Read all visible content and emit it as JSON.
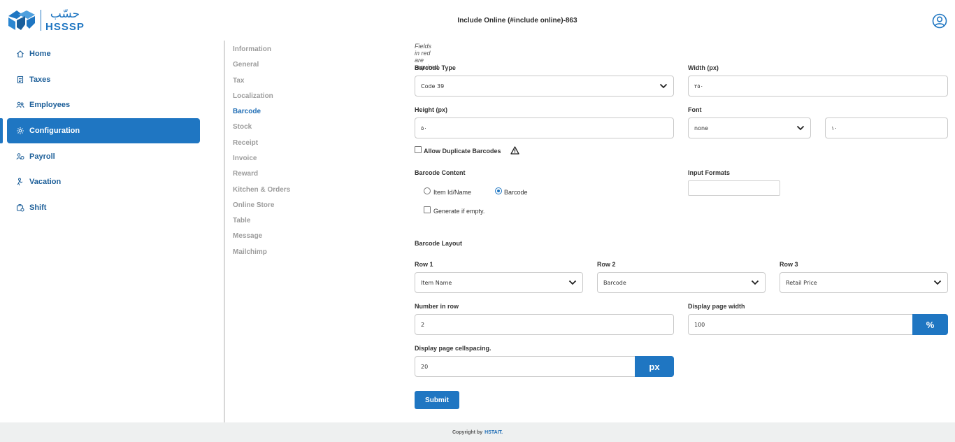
{
  "header": {
    "logo_ar": "حسّب",
    "logo_en": "HSSSP",
    "title": "Include Online (#include online)-863"
  },
  "sidebar": {
    "items": [
      {
        "label": "Home",
        "icon": "home-icon"
      },
      {
        "label": "Taxes",
        "icon": "receipt-icon"
      },
      {
        "label": "Employees",
        "icon": "users-icon"
      },
      {
        "label": "Configuration",
        "icon": "gear-icon",
        "active": true
      },
      {
        "label": "Payroll",
        "icon": "payroll-icon"
      },
      {
        "label": "Vacation",
        "icon": "vacation-icon"
      },
      {
        "label": "Shift",
        "icon": "shift-icon"
      }
    ]
  },
  "subnav": {
    "items": [
      "Information",
      "General",
      "Tax",
      "Localization",
      "Barcode",
      "Stock",
      "Receipt",
      "Invoice",
      "Reward",
      "Kitchen & Orders",
      "Online Store",
      "Table",
      "Message",
      "Mailchimp"
    ],
    "active": "Barcode"
  },
  "form": {
    "required_note": "Fields in red are required",
    "barcode_type": {
      "label": "Barcode Type",
      "value": "Code 39"
    },
    "width": {
      "label": "Width (px)",
      "value": "٢٥٠"
    },
    "height": {
      "label": "Height (px)",
      "value": "٥٠"
    },
    "font": {
      "label": "Font",
      "value": "none",
      "size": "١٠"
    },
    "allow_duplicates": {
      "label": "Allow Duplicate Barcodes",
      "checked": false
    },
    "barcode_content": {
      "label": "Barcode Content",
      "options": [
        "Item Id/Name",
        "Barcode"
      ],
      "selected": "Barcode",
      "generate_label": "Generate if empty.",
      "generate_checked": false
    },
    "input_formats": {
      "label": "Input Formats",
      "value": ""
    },
    "layout": {
      "title": "Barcode Layout",
      "row1": {
        "label": "Row 1",
        "value": "Item Name"
      },
      "row2": {
        "label": "Row 2",
        "value": "Barcode"
      },
      "row3": {
        "label": "Row 3",
        "value": "Retail Price"
      }
    },
    "number_in_row": {
      "label": "Number in row",
      "value": "2"
    },
    "page_width": {
      "label": "Display page width",
      "value": "100",
      "unit": "%"
    },
    "cellspacing": {
      "label": "Display page cellspacing.",
      "value": "20",
      "unit": "px"
    },
    "submit_label": "Submit"
  },
  "footer": {
    "text": "Copyright by",
    "brand": "HSTAIT."
  },
  "colors": {
    "primary": "#1f76c2",
    "nav_text": "#1d5f99",
    "subnav_muted": "#9c9c9c"
  }
}
